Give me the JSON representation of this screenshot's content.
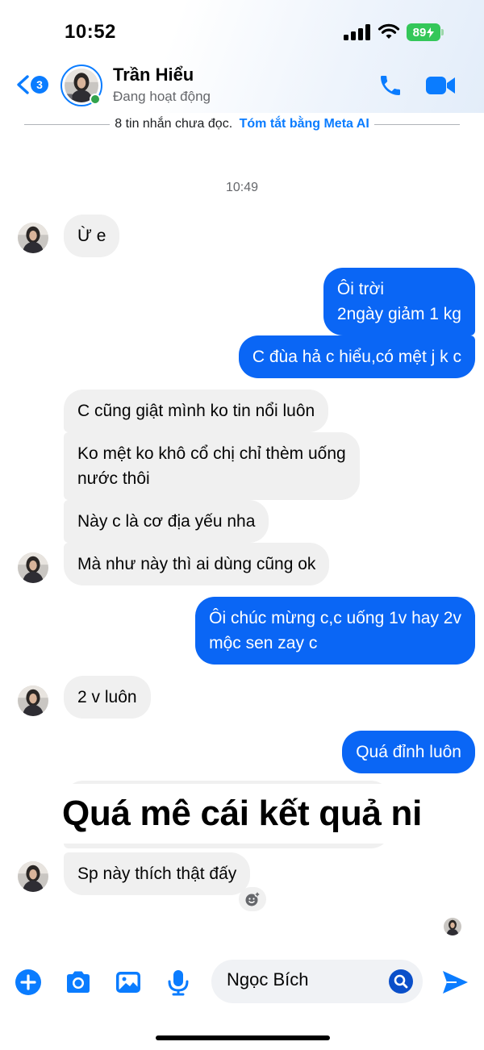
{
  "status_bar": {
    "time": "10:52",
    "battery": "89"
  },
  "header": {
    "back_count": "3",
    "contact_name": "Trần Hiểu",
    "contact_status": "Đang hoạt động"
  },
  "unread_banner": {
    "text": "8 tin nhắn chưa đọc.",
    "link": "Tóm tắt bằng Meta AI"
  },
  "timestamp": "10:49",
  "messages": [
    {
      "side": "in",
      "text": "Ừ e"
    },
    {
      "side": "out",
      "lines": [
        "Ôi trời",
        "2ngày giảm 1 kg"
      ]
    },
    {
      "side": "out",
      "text": "C đùa hả c hiểu,có mệt j k c"
    },
    {
      "side": "in",
      "text": "C cũng giật mình ko tin nổi luôn"
    },
    {
      "side": "in",
      "lines": [
        "Ko mệt ko khô cổ chị chỉ thèm uống",
        "nước thôi"
      ]
    },
    {
      "side": "in",
      "text": "Này c là cơ địa yếu nha"
    },
    {
      "side": "in",
      "text": "Mà như này thì ai dùng cũng ok"
    },
    {
      "side": "out",
      "lines": [
        "Ôi chúc mừng c,c uống 1v hay 2v",
        "mộc sen zay c"
      ]
    },
    {
      "side": "in",
      "text": "2 v luôn"
    },
    {
      "side": "out",
      "text": "Quá đỉnh luôn"
    },
    {
      "side": "in",
      "text": "Sp này thích thật đấy"
    }
  ],
  "overlay_caption": "Quá mê cái kết quả ni",
  "composer": {
    "input_text": "Ngọc Bích"
  },
  "colors": {
    "accent": "#0a7cff",
    "outgoing_bubble": "#0a66f5",
    "incoming_bubble": "#f0f0f0"
  }
}
